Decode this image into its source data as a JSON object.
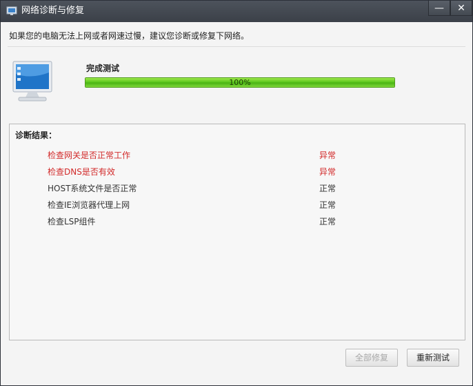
{
  "window": {
    "title": "网络诊断与修复",
    "minimize_glyph": "—",
    "close_glyph": "✕"
  },
  "hint": "如果您的电脑无法上网或者网速过慢，建议您诊断或修复下网络。",
  "status": {
    "label": "完成测试",
    "progress": 100,
    "progress_text": "100%"
  },
  "results": {
    "title": "诊断结果：",
    "rows": [
      {
        "name": "检查网关是否正常工作",
        "state": "异常"
      },
      {
        "name": "检查DNS是否有效",
        "state": "异常"
      },
      {
        "name": "HOST系统文件是否正常",
        "state": "正常"
      },
      {
        "name": "检查IE浏览器代理上网",
        "state": "正常"
      },
      {
        "name": "检查LSP组件",
        "state": "正常"
      }
    ]
  },
  "buttons": {
    "repair_all": "全部修复",
    "retest": "重新测试"
  },
  "colors": {
    "error": "#d22a2a",
    "progress": "#55c41a",
    "titlebar": "#3b4048"
  },
  "icons": {
    "app": "network-monitor-icon",
    "monitor": "computer-monitor-icon"
  }
}
